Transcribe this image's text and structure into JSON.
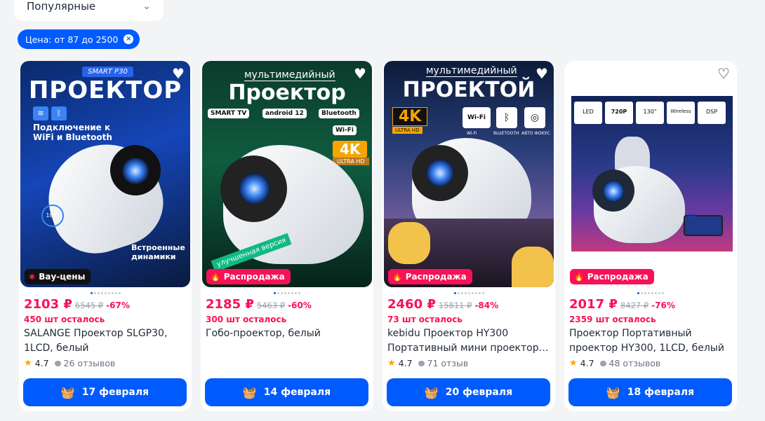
{
  "sort": {
    "label": "Популярные"
  },
  "filter_chip": {
    "label": "Цена: от 87 до 2500"
  },
  "products": [
    {
      "image": {
        "top_badge": "SMART P30",
        "headline": "ПРОЕКТОР",
        "feature1": "Подключение к",
        "feature1b": "WiFi и Bluetooth",
        "feature2": "Встроенные",
        "feature2b": "динамики",
        "angle": "180°"
      },
      "badge": "Вау-цены",
      "price": "2103 ₽",
      "old_price": "6545 ₽",
      "discount": "-67%",
      "stock": "450 шт осталось",
      "title": "SALANGE Проектор SLGP30, 1LCD, белый",
      "rating": "4.7",
      "reviews": "26 отзывов",
      "delivery": "17 февраля"
    },
    {
      "image": {
        "subtitle": "мультимедийный",
        "headline": "Проектор",
        "chip1": "SMART TV",
        "chip2": "android 12",
        "chip3": "Bluetooth",
        "chip4": "Wi-Fi",
        "res": "4K",
        "res_sub": "ULTRA HD",
        "ribbon": "улучшенная версия"
      },
      "badge": "Распродажа",
      "price": "2185 ₽",
      "old_price": "5463 ₽",
      "discount": "-60%",
      "stock": "300 шт осталось",
      "title": "Гобо-проектор, белый",
      "rating": "",
      "reviews": "",
      "delivery": "14 февраля"
    },
    {
      "image": {
        "subtitle": "мультимедийный",
        "headline": "ПРОЕКТОЙ",
        "res": "4K",
        "res_sub": "ULTRA HD",
        "icon1": "Wi-Fi",
        "icon2": "BLUETOOTH",
        "icon3": "АВТО ФОКУС"
      },
      "badge": "Распродажа",
      "price": "2460 ₽",
      "old_price": "15811 ₽",
      "discount": "-84%",
      "stock": "73 шт осталось",
      "title": "kebidu Проектор HY300 Портативный мини проектор…",
      "rating": "4.7",
      "reviews": "71 отзыв",
      "delivery": "20 февраля"
    },
    {
      "image": {
        "f1": "LED",
        "f2": "720P",
        "f3": "130\"",
        "f4": "Wireless",
        "f5": "DSP"
      },
      "badge": "Распродажа",
      "price": "2017 ₽",
      "old_price": "8427 ₽",
      "discount": "-76%",
      "stock": "2359 шт осталось",
      "title": "Проектор Портативный проектор HY300, 1LCD, белый",
      "rating": "4.7",
      "reviews": "48 отзывов",
      "delivery": "18 февраля"
    }
  ]
}
